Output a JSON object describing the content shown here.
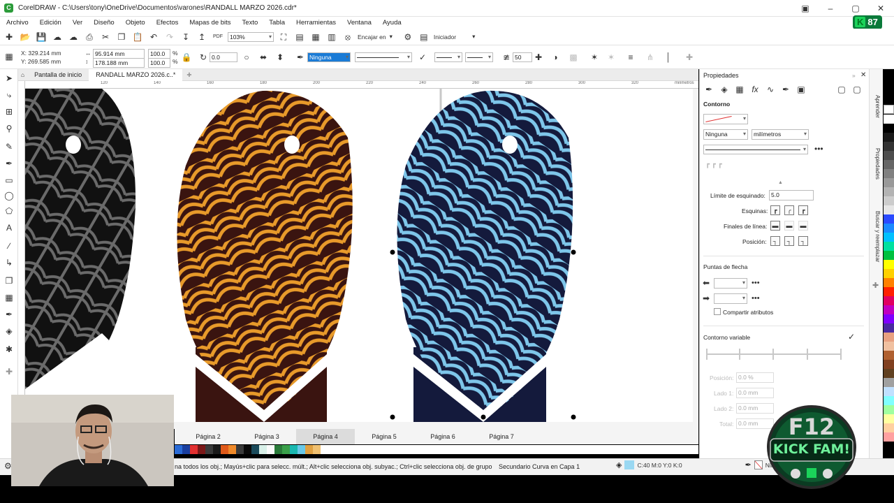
{
  "window": {
    "title": "CorelDRAW - C:\\Users\\tony\\OneDrive\\Documentos\\varones\\RANDALL MARZO 2026.cdr*",
    "badge_text": "87",
    "badge_letter": "K"
  },
  "menu": [
    "Archivo",
    "Edición",
    "Ver",
    "Diseño",
    "Objeto",
    "Efectos",
    "Mapas de bits",
    "Texto",
    "Tabla",
    "Herramientas",
    "Ventana",
    "Ayuda"
  ],
  "std_toolbar": {
    "zoom": "103%",
    "snap_label": "Encajar en",
    "workspace_label": "Iniciador"
  },
  "prop_toolbar": {
    "x": "X: 329.214 mm",
    "y": "Y: 269.585 mm",
    "width": "95.914 mm",
    "height": "178.188 mm",
    "scale_w": "100.0",
    "scale_h": "100.0",
    "pct": "%",
    "rotation": "0.0",
    "outline_width": "Ninguna",
    "miter": "50"
  },
  "doc_tabs": [
    "Pantalla de inicio",
    "RANDALL MARZO 2026.c..*"
  ],
  "ruler_labels": [
    "120",
    "140",
    "160",
    "180",
    "200",
    "220",
    "240",
    "260",
    "280",
    "300",
    "320",
    "340",
    "milímetros"
  ],
  "pages": [
    "Página 2",
    "Página 3",
    "Página 4",
    "Página 5",
    "Página 6",
    "Página 7"
  ],
  "active_page": "Página 4",
  "status": {
    "hint": "na todos los obj.; Mayús+clic para selecc. múlt.; Alt+clic selecciona obj. subyac.; Ctrl+clic selecciona obj. de grupo",
    "selection": "Secundario Curva en Capa 1",
    "fill_color": "C:40 M:0 Y:0 K:0",
    "outline": "Ning"
  },
  "docker": {
    "title": "Propiedades",
    "section": "Contorno",
    "width_value": "Ninguna",
    "units": "milímetros",
    "miter_label": "Límite de esquinado:",
    "miter_value": "5.0",
    "corners_label": "Esquinas:",
    "line_caps_label": "Finales de línea:",
    "position_label": "Posición:",
    "arrowheads_label": "Puntas de flecha",
    "share_attrs_label": "Compartir atributos",
    "variable_outline_label": "Contorno variable",
    "dim_fields": [
      {
        "label": "Posición:",
        "value": "0.0 %"
      },
      {
        "label": "Lado 1:",
        "value": "0.0 mm"
      },
      {
        "label": "Lado 2:",
        "value": "0.0 mm"
      },
      {
        "label": "Total:",
        "value": "0.0 mm"
      }
    ]
  },
  "side_tabs": [
    "Aprender",
    "Propiedades",
    "Buscar y reemplazar"
  ],
  "logo_text": {
    "line1": "F12",
    "line2": "KICK FAM!"
  },
  "colors": {
    "palette_bottom": [
      "#2a6bd6",
      "#1a3fa0",
      "#e23030",
      "#7a1818",
      "#3a3a3a",
      "#1a1a1a",
      "#e05a1a",
      "#f08a2a",
      "#3a3a3a",
      "#0a0a0a",
      "#1a4a5a",
      "#d8f0e8",
      "#fafafa",
      "#2a7a3a",
      "#3aa04a",
      "#1ab8b0",
      "#68c8e8",
      "#e0a040",
      "#f0c070"
    ],
    "palette_right": [
      "#ffffff",
      "#000000",
      "#1a1a1a",
      "#333333",
      "#4d4d4d",
      "#666666",
      "#808080",
      "#999999",
      "#b3b3b3",
      "#cccccc",
      "#e6e6e6",
      "#2a4aff",
      "#1a8aff",
      "#00c0ff",
      "#00e0a0",
      "#00c040",
      "#ffff00",
      "#ffd000",
      "#ff8000",
      "#ff2000",
      "#e00060",
      "#c000c0",
      "#8000ff",
      "#4a2aa0",
      "#e8a080",
      "#f0c0a0",
      "#b06030",
      "#804020",
      "#604020",
      "#a0a0a0",
      "#c0e0ff",
      "#80ffff",
      "#a0ffa0",
      "#ffffa0",
      "#ffd0a0",
      "#ffa0a0"
    ],
    "accent": "#1a7bd6"
  }
}
